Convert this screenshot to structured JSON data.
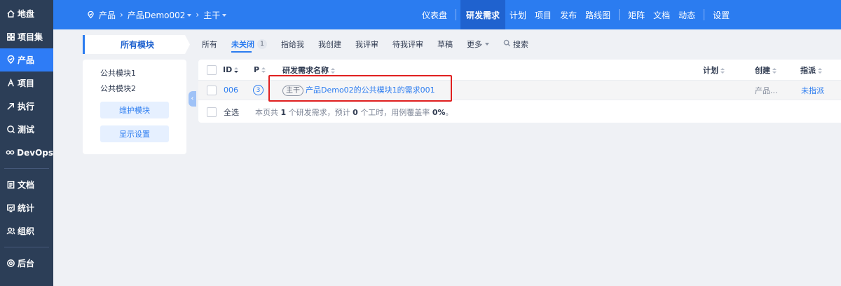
{
  "leftnav": {
    "items": [
      {
        "label": "地盘",
        "icon": "home-icon"
      },
      {
        "label": "项目集",
        "icon": "grid-icon"
      },
      {
        "label": "产品",
        "icon": "product-icon",
        "active": true
      },
      {
        "label": "项目",
        "icon": "project-icon"
      },
      {
        "label": "执行",
        "icon": "execution-icon"
      },
      {
        "label": "测试",
        "icon": "test-icon"
      },
      {
        "label": "DevOps",
        "icon": "devops-icon"
      },
      {
        "label": "文档",
        "icon": "doc-icon"
      },
      {
        "label": "统计",
        "icon": "stats-icon"
      },
      {
        "label": "组织",
        "icon": "org-icon"
      },
      {
        "label": "后台",
        "icon": "settings-icon"
      }
    ]
  },
  "header": {
    "crumb_product": "产品",
    "crumb_name": "产品Demo002",
    "crumb_branch": "主干",
    "nav": [
      "仪表盘",
      "研发需求",
      "计划",
      "项目",
      "发布",
      "路线图",
      "矩阵",
      "文档",
      "动态",
      "设置"
    ],
    "active": "研发需求"
  },
  "modules": {
    "tab": "所有模块",
    "items": [
      "公共模块1",
      "公共模块2"
    ],
    "maintain_button": "维护模块",
    "display_button": "显示设置"
  },
  "filters": {
    "all": "所有",
    "unclosed": "未关闭",
    "unclosed_count": "1",
    "assigned": "指给我",
    "created": "我创建",
    "reviewed": "我评审",
    "to_review": "待我评审",
    "draft": "草稿",
    "more": "更多",
    "search": "搜索"
  },
  "table": {
    "columns": {
      "id": "ID",
      "p": "P",
      "name": "研发需求名称",
      "plan": "计划",
      "created": "创建",
      "assigned": "指派"
    },
    "rows": [
      {
        "id": "006",
        "p": "3",
        "branch": "主干",
        "name": "产品Demo02的公共模块1的需求001",
        "created": "产品...",
        "assigned": "未指派"
      }
    ],
    "footer": {
      "select_all": "全选",
      "summary_prefix": "本页共",
      "count": "1",
      "summary_mid": "个研发需求，预计",
      "hours": "0",
      "summary_mid2": "个工时，用例覆盖率",
      "coverage": "0%",
      "summary_end": "。"
    }
  },
  "colors": {
    "accent": "#2b7cf0",
    "nav_bg": "#2c3e57",
    "highlight": "#e02020"
  }
}
